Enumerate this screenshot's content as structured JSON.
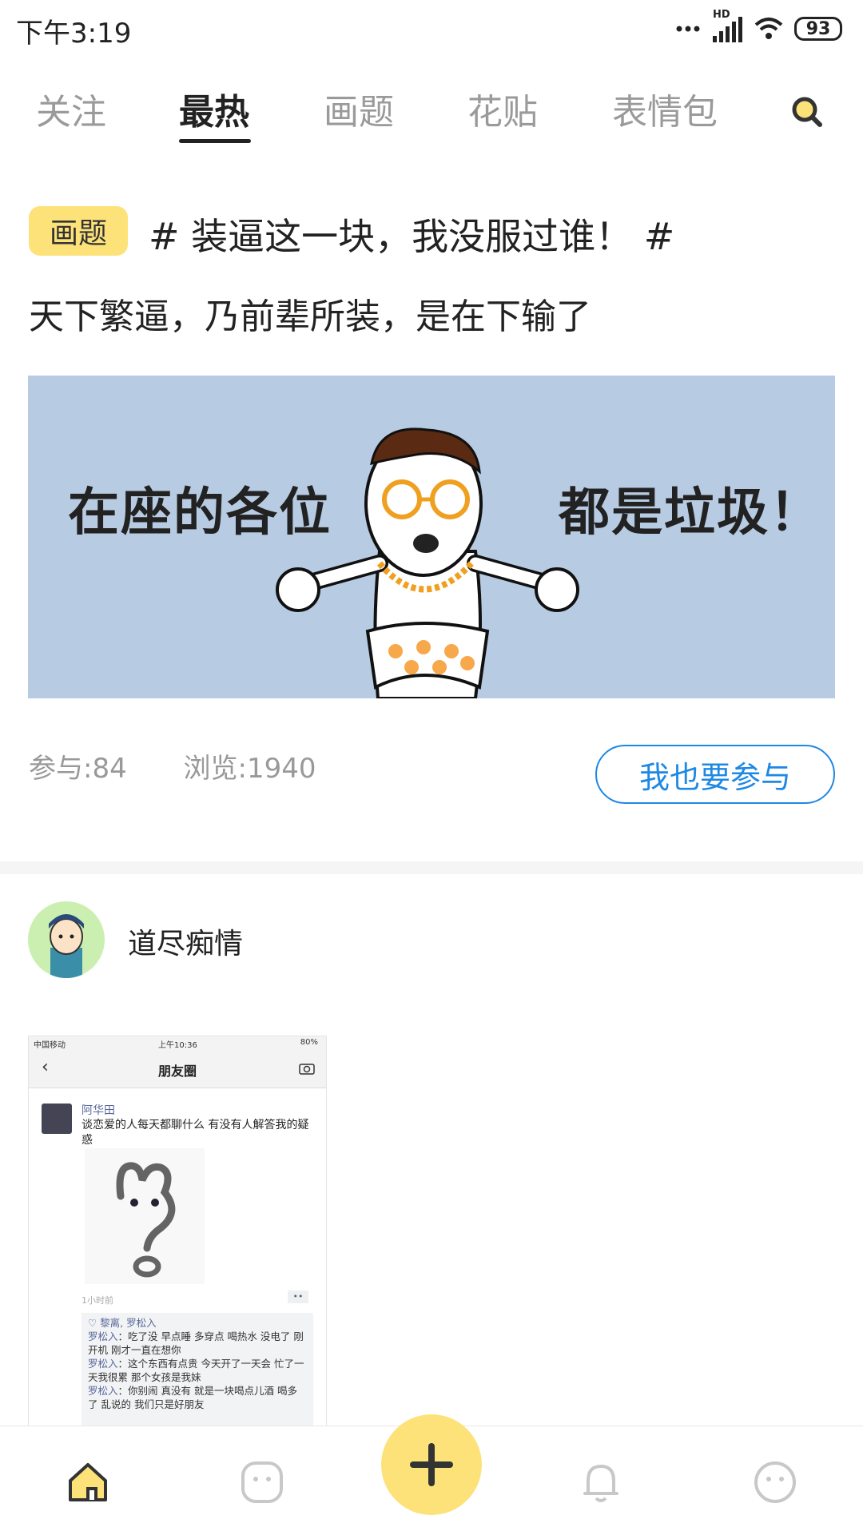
{
  "status_bar": {
    "time": "下午3:19",
    "network": "HD",
    "battery": "93"
  },
  "tabs": [
    {
      "label": "关注",
      "active": false
    },
    {
      "label": "最热",
      "active": true
    },
    {
      "label": "画题",
      "active": false
    },
    {
      "label": "花贴",
      "active": false
    },
    {
      "label": "表情包",
      "active": false
    }
  ],
  "topic": {
    "badge": "画题",
    "title": "# 装逼这一块，我没服过谁！ #",
    "subtitle": "天下繁逼，乃前辈所装，是在下输了",
    "banner_left_text": "在座的各位",
    "banner_right_text": "都是垃圾！",
    "participants": "参与:84",
    "views": "浏览:1940",
    "join_label": "我也要参与"
  },
  "post": {
    "username": "道尽痴情",
    "screenshot": {
      "carrier": "中国移动",
      "time": "上午10:36",
      "battery": "80%",
      "title": "朋友圈",
      "author": "阿华田",
      "text": "谈恋爱的人每天都聊什么 有没有人解答我的疑惑",
      "post_time": "1小时前",
      "likes": "♡ 黎离, 罗松入",
      "comments": [
        {
          "name": "罗松入",
          "text": "吃了没 早点睡 多穿点 喝热水 没电了 刚开机 刚才一直在想你"
        },
        {
          "name": "罗松入",
          "text": "这个东西有点贵 今天开了一天会 忙了一天我很累 那个女孩是我妹"
        },
        {
          "name": "罗松入",
          "text": "你别闹 真没有 就是一块喝点儿酒 喝多了 乱说的 我们只是好朋友"
        }
      ]
    }
  },
  "bottom_nav": [
    {
      "icon": "home-icon",
      "active": true
    },
    {
      "icon": "category-icon",
      "active": false
    },
    {
      "icon": "plus-icon",
      "active": false
    },
    {
      "icon": "bell-icon",
      "active": false
    },
    {
      "icon": "profile-icon",
      "active": false
    }
  ],
  "colors": {
    "accent": "#fde27a",
    "link": "#1e88e5",
    "banner_bg": "#b7cbe3"
  }
}
